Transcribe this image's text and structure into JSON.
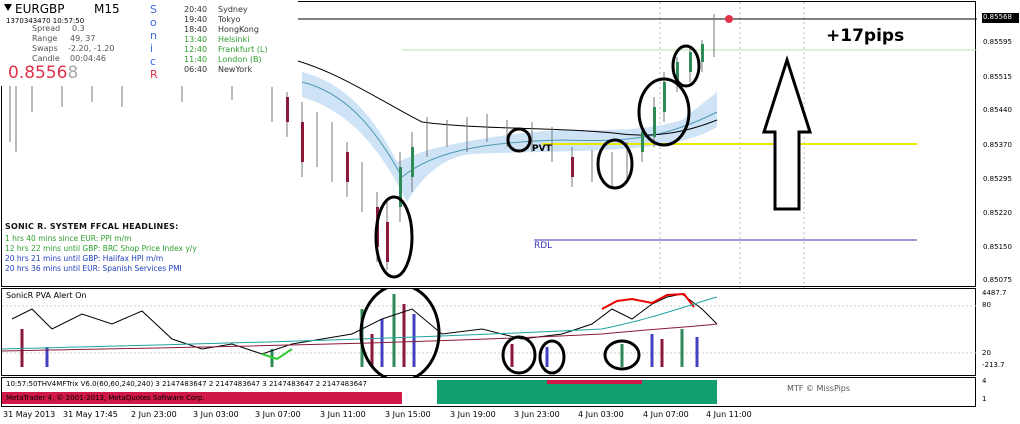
{
  "header": {
    "symbol": "EURGBP",
    "timeframe": "M15",
    "timestamp": "1370343470 10:57:50",
    "spread_label": "Spread",
    "spread_value": "0.3",
    "range_label": "Range",
    "range_value": "49, 37",
    "swaps_label": "Swaps",
    "swaps_value": "-2.20, -1.20",
    "candle_label": "Candle",
    "candle_value": "00:04:46",
    "price_main": "0.8556",
    "price_last": "8",
    "sonic_letters": [
      "S",
      "o",
      "n",
      "i",
      "c",
      "R"
    ]
  },
  "sessions": [
    {
      "time": "20:40",
      "city": "Sydney",
      "color": "#333333"
    },
    {
      "time": "19:40",
      "city": "Tokyo",
      "color": "#333333"
    },
    {
      "time": "18:40",
      "city": "HongKong",
      "color": "#333333"
    },
    {
      "time": "13:40",
      "city": "Helsinki",
      "color": "#2e9e2e"
    },
    {
      "time": "12:40",
      "city": "Frankfurt  (L)",
      "color": "#2e9e2e"
    },
    {
      "time": "11:40",
      "city": "London  (B)",
      "color": "#2e9e2e"
    },
    {
      "time": "06:40",
      "city": "NewYork",
      "color": "#333333"
    }
  ],
  "headlines": {
    "title": "SONIC R. SYSTEM  FFCAL HEADLINES:",
    "items": [
      {
        "text": "1 hrs 40 mins since EUR: PPI m/m",
        "color": "#2e9e2e"
      },
      {
        "text": "12 hrs 22 mins until GBP: BRC Shop Price Index y/y",
        "color": "#2e9e2e"
      },
      {
        "text": "20 hrs 21 mins until GBP: Halifax HPI m/m",
        "color": "#1f3fbf"
      },
      {
        "text": "20 hrs 36 mins until EUR: Spanish Services PMI",
        "color": "#1f3fbf"
      }
    ]
  },
  "chart_labels": {
    "pips": "+17pips",
    "pvt": "PVT",
    "rdl": "RDL",
    "current_price": "0.85568"
  },
  "price_axis": [
    "0.85595",
    "0.85515",
    "0.85440",
    "0.85370",
    "0.85295",
    "0.85220",
    "0.85150",
    "0.85075",
    "0.85005"
  ],
  "pva": {
    "title": "SonicR PVA   Alert On",
    "axis": [
      "4487.7",
      "80",
      "20",
      "-213.7"
    ]
  },
  "trix": {
    "label": "10:57:50THV4MFTrix V6.0(60,60,240,240) 3 2147483647 2 2147483647 3 2147483647 2 2147483647",
    "copyright": "MetaTrader 4, © 2001-2013, MetaQuotes Software Corp.",
    "mtf": "MTF © MissPips",
    "axis": [
      "4",
      "1"
    ]
  },
  "time_axis": [
    "31 May 2013",
    "31 May 17:45",
    "2 Jun 23:00",
    "3 Jun 03:00",
    "3 Jun 07:00",
    "3 Jun 11:00",
    "3 Jun 15:00",
    "3 Jun 19:00",
    "3 Jun 23:00",
    "4 Jun 03:00",
    "4 Jun 07:00",
    "4 Jun 11:00"
  ],
  "colors": {
    "up": "#2e8b57",
    "down": "#8b1a3a",
    "accent": "#e0304a",
    "pvt": "#e8e800",
    "rdl": "#3a3ab0"
  }
}
